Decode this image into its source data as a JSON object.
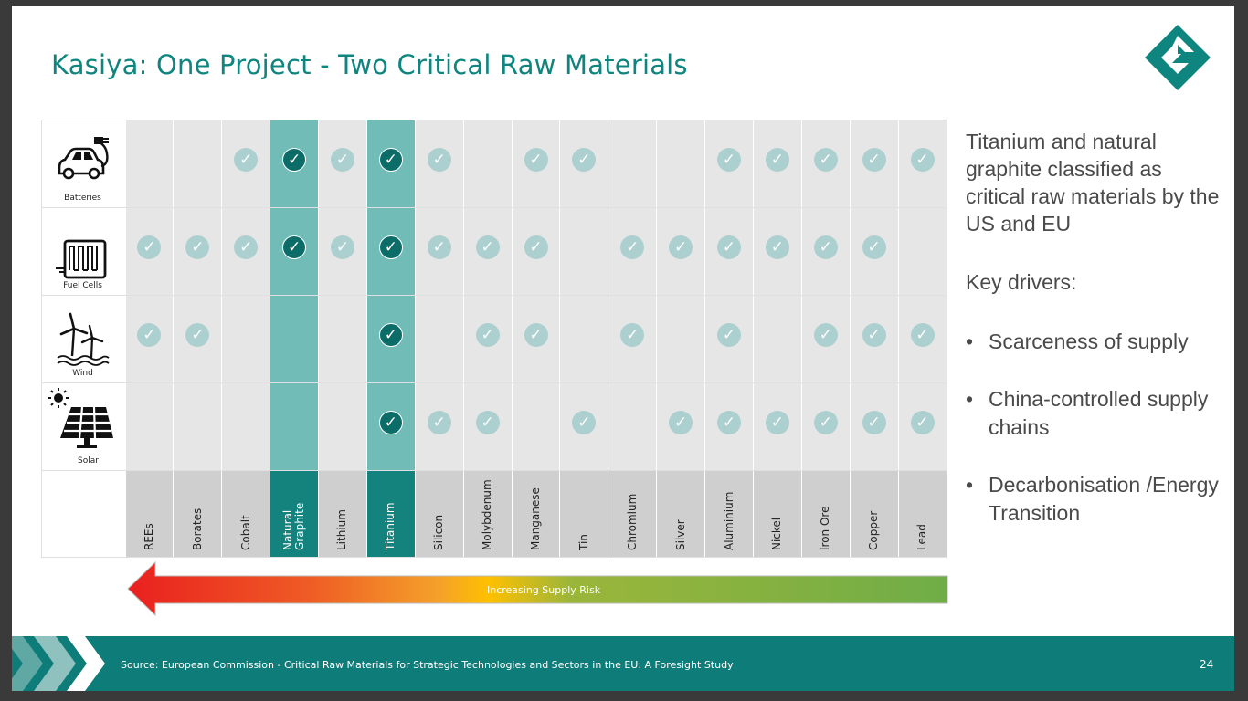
{
  "title": "Kasiya: One Project - Two Critical Raw Materials",
  "technologies": [
    "Batteries",
    "Fuel Cells",
    "Wind",
    "Solar"
  ],
  "materials": [
    "REEs",
    "Borates",
    "Cobalt",
    "Natural\nGraphite",
    "Lithium",
    "Titanium",
    "Silicon",
    "Molybdenum",
    "Manganese",
    "Tin",
    "Chromium",
    "Silver",
    "Aluminium",
    "Nickel",
    "Iron Ore",
    "Copper",
    "Lead"
  ],
  "highlighted_materials": [
    "Natural\nGraphite",
    "Titanium"
  ],
  "checks": {
    "Batteries": [
      0,
      0,
      1,
      1,
      1,
      1,
      1,
      0,
      1,
      1,
      0,
      0,
      1,
      1,
      1,
      1,
      1
    ],
    "Fuel Cells": [
      1,
      1,
      1,
      1,
      1,
      1,
      1,
      1,
      1,
      0,
      1,
      1,
      1,
      1,
      1,
      1,
      0
    ],
    "Wind": [
      1,
      1,
      0,
      0,
      0,
      1,
      0,
      1,
      1,
      0,
      1,
      0,
      1,
      0,
      1,
      1,
      1
    ],
    "Solar": [
      0,
      0,
      0,
      0,
      0,
      1,
      1,
      1,
      0,
      1,
      0,
      1,
      1,
      1,
      1,
      1,
      1
    ]
  },
  "arrow_label": "Increasing Supply Risk",
  "side": {
    "paragraph": "Titanium and natural graphite classified as critical raw materials by the US and EU",
    "drivers_heading": "Key drivers:",
    "bullets": [
      "Scarceness of supply",
      "China-controlled supply chains",
      "Decarbonisation /Energy Transition"
    ]
  },
  "footer": {
    "source": "Source: European Commission - Critical Raw Materials for Strategic Technologies and Sectors in the EU: A Foresight Study",
    "page_number": "24"
  },
  "colors": {
    "teal": "#0f8580",
    "highlight_column": "#72bcb8",
    "light_check": "#acd0cf",
    "dark_check": "#0b6c68",
    "footer": "#0e7c78"
  }
}
